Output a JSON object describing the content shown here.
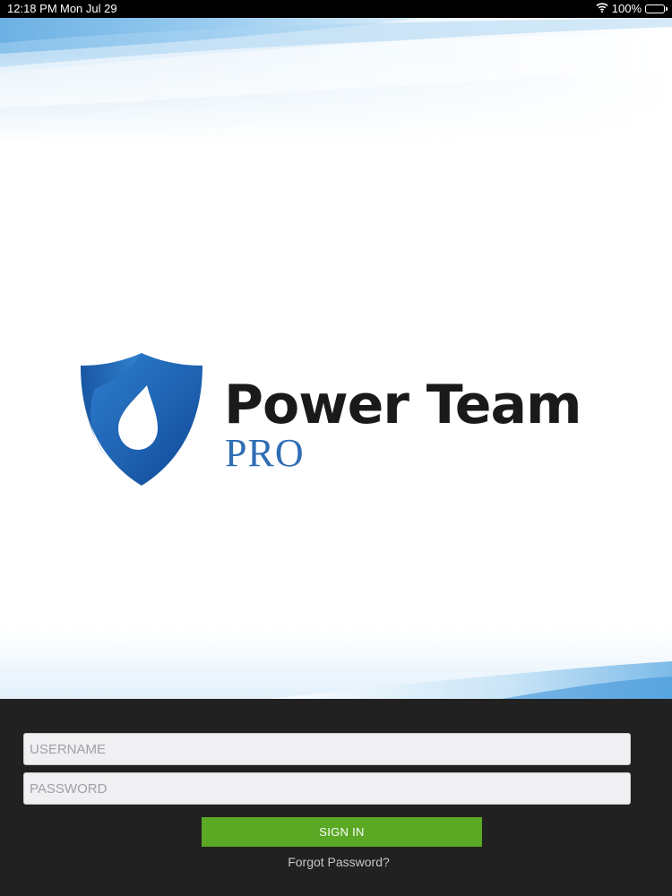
{
  "status_bar": {
    "time": "12:18 PM",
    "date": "Mon Jul 29",
    "battery_percent": "100%",
    "icons": [
      "wifi-icon",
      "battery-icon"
    ]
  },
  "logo": {
    "brand_name": "Power Team",
    "brand_sub": "PRO",
    "icon": "shield-drop-icon"
  },
  "login": {
    "username_placeholder": "USERNAME",
    "username_value": "",
    "password_placeholder": "PASSWORD",
    "password_value": "",
    "sign_in_label": "SIGN IN",
    "forgot_password_label": "Forgot Password?"
  },
  "colors": {
    "panel_bg": "#212121",
    "button_green": "#5aa824",
    "brand_blue": "#2f6db5",
    "text_dark": "#1a1a1a"
  }
}
